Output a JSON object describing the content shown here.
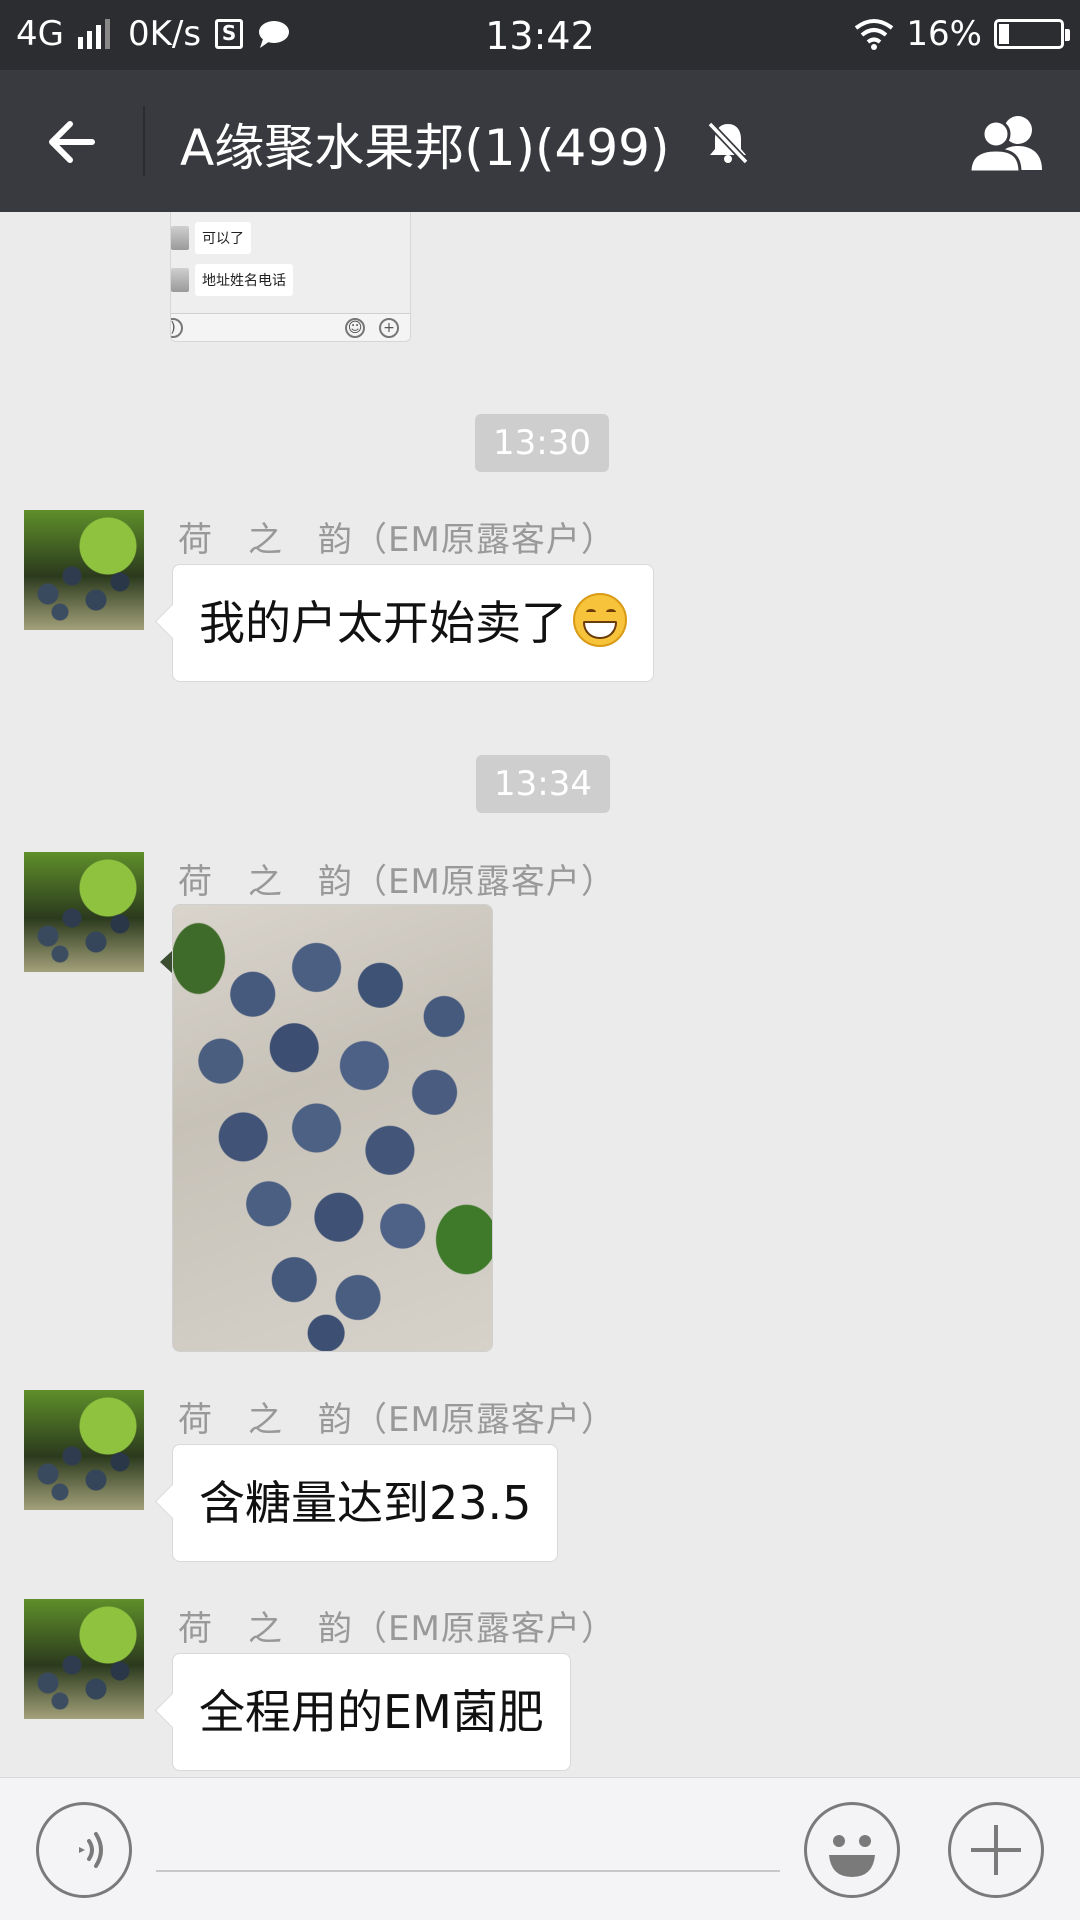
{
  "status_bar": {
    "network": "4G",
    "speed": "0K/s",
    "sim_icon_glyph": "S",
    "time": "13:42",
    "battery": "16%",
    "battery_level": 0.16,
    "icons": [
      "signal-icon",
      "sim-icon",
      "chat-notification-icon",
      "wifi-icon",
      "battery-icon"
    ]
  },
  "nav": {
    "back_icon": "back-arrow-icon",
    "title": "A缘聚水果邦(1)(499)",
    "mute_icon": "mute-bell-icon",
    "group_icon": "group-members-icon"
  },
  "quoted_screenshot": {
    "lines": [
      "可以了",
      "地址姓名电话"
    ]
  },
  "messages": [
    {
      "type": "time",
      "text": "13:30"
    },
    {
      "type": "text",
      "sender": "荷　之　韵（EM原露客户）",
      "text": "我的户太开始卖了",
      "emoji": "grinning-face-emoji"
    },
    {
      "type": "time",
      "text": "13:34"
    },
    {
      "type": "image",
      "sender": "荷　之　韵（EM原露客户）",
      "image": "grape-cluster-photo"
    },
    {
      "type": "text",
      "sender": "荷　之　韵（EM原露客户）",
      "text": "含糖量达到23.5"
    },
    {
      "type": "text",
      "sender": "荷　之　韵（EM原露客户）",
      "text": "全程用的EM菌肥"
    }
  ],
  "input_bar": {
    "voice_icon": "voice-input-icon",
    "emoji_icon": "emoji-icon",
    "plus_icon": "plus-icon",
    "text_value": ""
  },
  "colors": {
    "status_bar_bg": "#2b2d30",
    "nav_bg": "#393a3f",
    "chat_bg": "#ebebeb",
    "time_pill_bg": "#cecece",
    "bubble_bg": "#ffffff"
  }
}
